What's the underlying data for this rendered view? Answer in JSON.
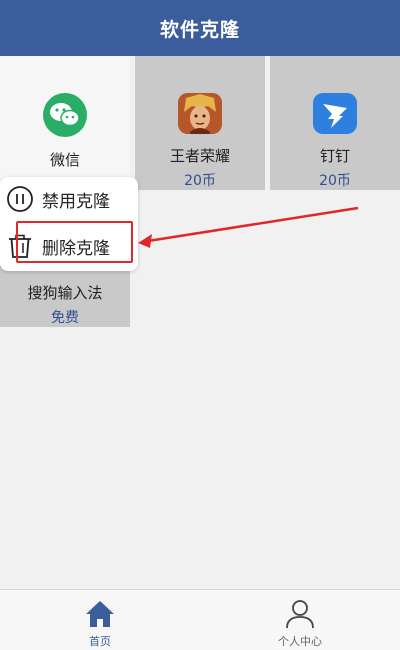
{
  "header": {
    "title": "软件克隆"
  },
  "apps": [
    {
      "name": "微信",
      "price": ""
    },
    {
      "name": "王者荣耀",
      "price": "20币"
    },
    {
      "name": "钉钉",
      "price": "20币"
    },
    {
      "name": "搜狗输入法",
      "price": "免费"
    }
  ],
  "context_menu": {
    "items": [
      {
        "label": "禁用克隆",
        "icon": "pause-icon"
      },
      {
        "label": "删除克隆",
        "icon": "trash-icon"
      }
    ]
  },
  "tab_bar": {
    "tabs": [
      {
        "label": "首页",
        "icon": "home-icon",
        "selected": true
      },
      {
        "label": "个人中心",
        "icon": "user-icon",
        "selected": false
      }
    ]
  },
  "colors": {
    "header_bg": "#3c5d9c",
    "tile_bg": "#c9c9c9",
    "price_text": "#2f4f8f",
    "highlight": "#e0282c",
    "tab_active": "#3c5d9c",
    "tab_inactive": "#666666"
  }
}
